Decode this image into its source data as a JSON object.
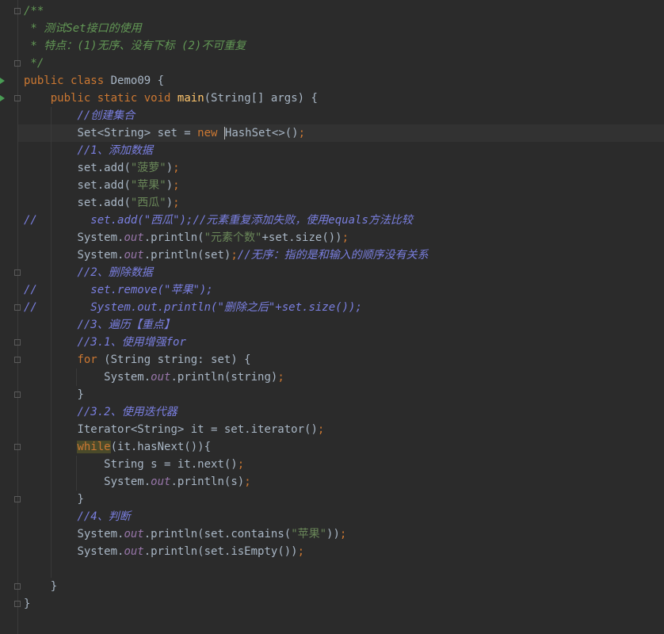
{
  "editor": {
    "file_comment": {
      "open": "/**",
      "line1": " * 测试Set接口的使用",
      "line2": " * 特点：(1)无序、没有下标 (2)不可重复",
      "close": " */"
    },
    "class_decl": {
      "kw1": "public",
      "kw2": "class",
      "name": "Demo09",
      "brace": " {"
    },
    "main_decl": {
      "kw1": "public",
      "kw2": "static",
      "kw3": "void",
      "name": "main",
      "params": "(String[] args) {"
    },
    "comments": {
      "create": "//创建集合",
      "add": "//1、添加数据",
      "remove": "//2、删除数据",
      "iterate": "//3、遍历【重点】",
      "foreach": "//3.1、使用增强for",
      "iterator": "//3.2、使用迭代器",
      "judge": "//4、判断",
      "dup_fail": "set.add(\"西瓜\");//元素重复添加失败，使用equals方法比较",
      "unordered": "//无序：指的是和输入的顺序没有关系",
      "remove_call": "set.remove(\"苹果\");",
      "remove_print": "System.out.println(\"删除之后\"+set.size());",
      "line_marker": "//"
    },
    "strings": {
      "pineapple": "\"菠萝\"",
      "apple": "\"苹果\"",
      "watermelon": "\"西瓜\"",
      "count": "\"元素个数\""
    },
    "code": {
      "set_decl_pre": "Set<String> set = ",
      "new_kw": "new",
      "hashset_h": "H",
      "hashset_rest": "ashSet<>()",
      "set_add": "set.add(",
      "close_paren": ")",
      "system": "System.",
      "out": "out",
      "println": ".println(",
      "println_count_tail": "+set.size())",
      "println_set": "set)",
      "for_kw": "for",
      "for_rest": " (String string: set) {",
      "println_string": "string)",
      "close_brace": "}",
      "iterator_decl": "Iterator<String> it = set.iterator()",
      "while_kw": "while",
      "while_rest": "(it.hasNext()){",
      "string_decl": "String s = it.next()",
      "println_s": "s)",
      "println_contains_pre": "set.contains(",
      "println_contains_post": "))",
      "println_empty": "set.isEmpty())",
      "semicolon": ";"
    }
  }
}
